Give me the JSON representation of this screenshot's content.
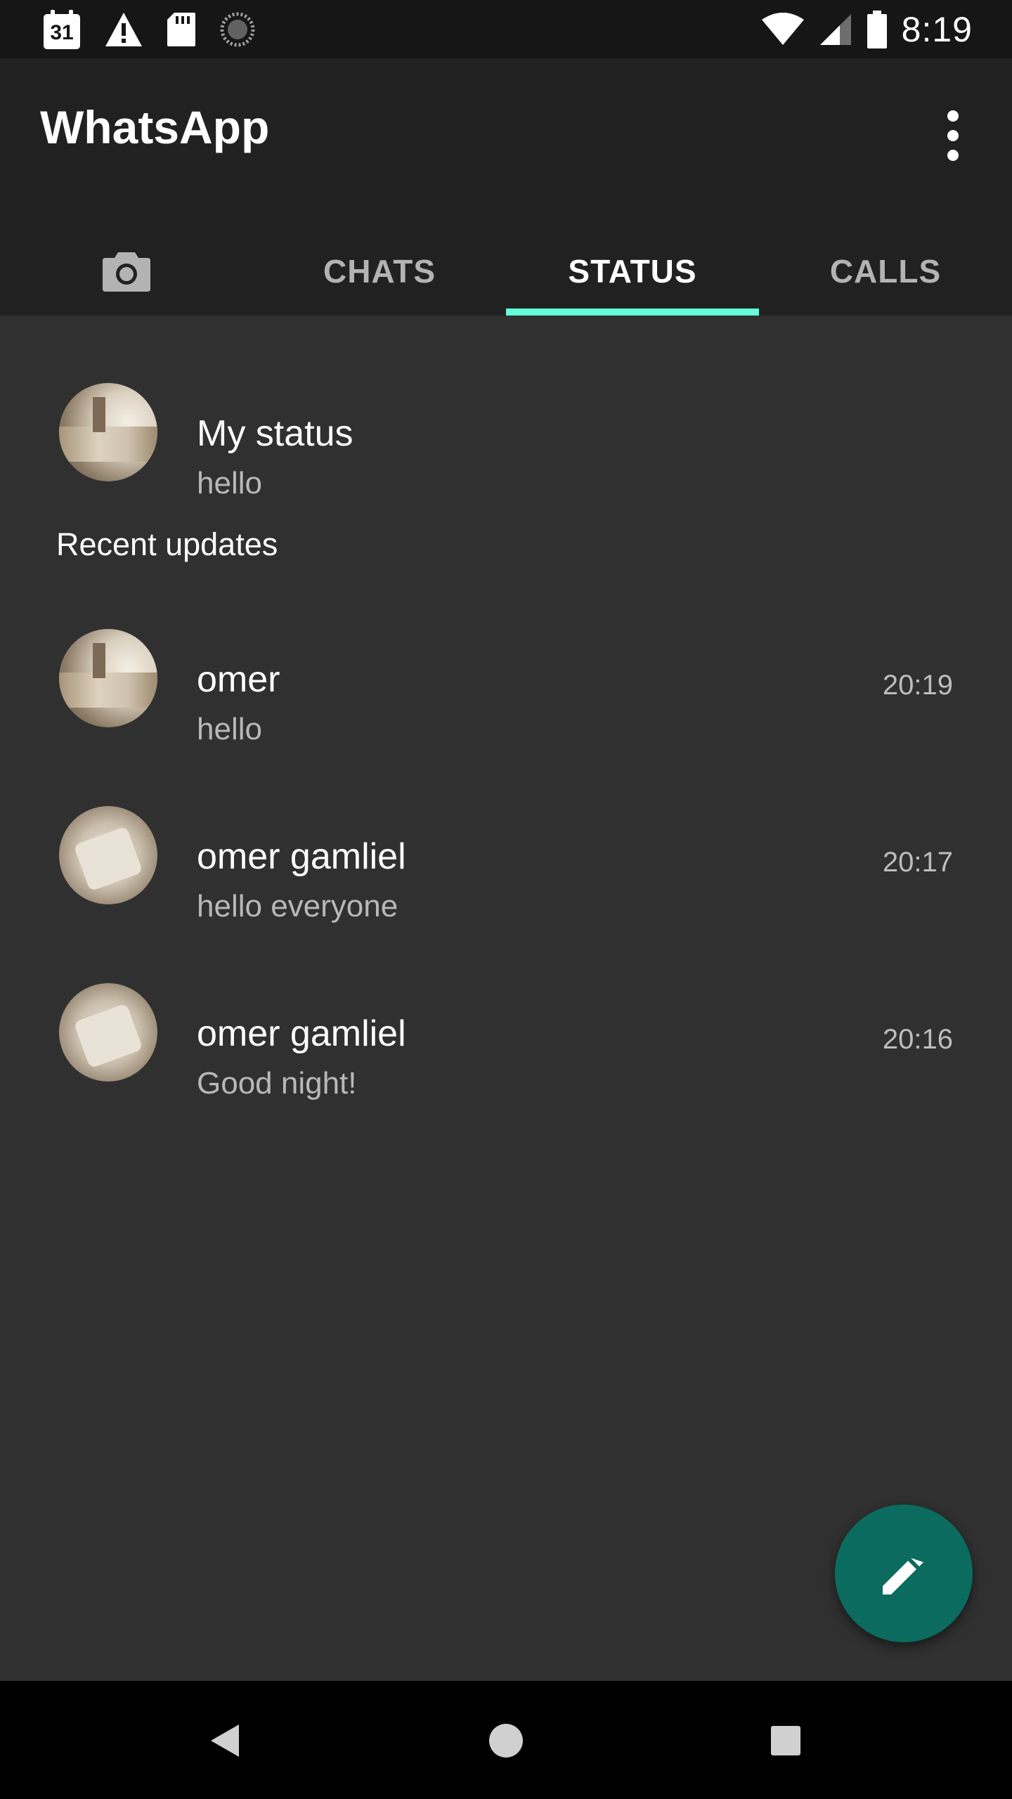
{
  "status_bar": {
    "calendar_day": "31",
    "time": "8:19",
    "icons": [
      "calendar-icon",
      "warning-icon",
      "sd-card-icon",
      "sync-icon",
      "wifi-icon",
      "cellular-signal-icon",
      "battery-icon"
    ]
  },
  "app_bar": {
    "title": "WhatsApp",
    "menu_icon": "overflow-menu-icon"
  },
  "tabs": {
    "camera_icon": "camera-icon",
    "items": [
      {
        "label": "CHATS",
        "active": false
      },
      {
        "label": "STATUS",
        "active": true
      },
      {
        "label": "CALLS",
        "active": false
      }
    ],
    "indicator_color": "#64ffda"
  },
  "my_status": {
    "title": "My status",
    "subtitle": "hello"
  },
  "recent": {
    "header": "Recent updates",
    "items": [
      {
        "name": "omer",
        "text": "hello",
        "time": "20:19"
      },
      {
        "name": "omer gamliel",
        "text": "hello everyone",
        "time": "20:17"
      },
      {
        "name": "omer gamliel",
        "text": "Good night!",
        "time": "20:16"
      }
    ]
  },
  "fab": {
    "icon": "pencil-icon",
    "color": "#0a6b5e"
  },
  "nav_bar": {
    "icons": [
      "back-icon",
      "home-icon",
      "recents-icon"
    ]
  },
  "colors": {
    "background": "#303030",
    "app_bar": "#212121",
    "status_bar": "#161616"
  }
}
